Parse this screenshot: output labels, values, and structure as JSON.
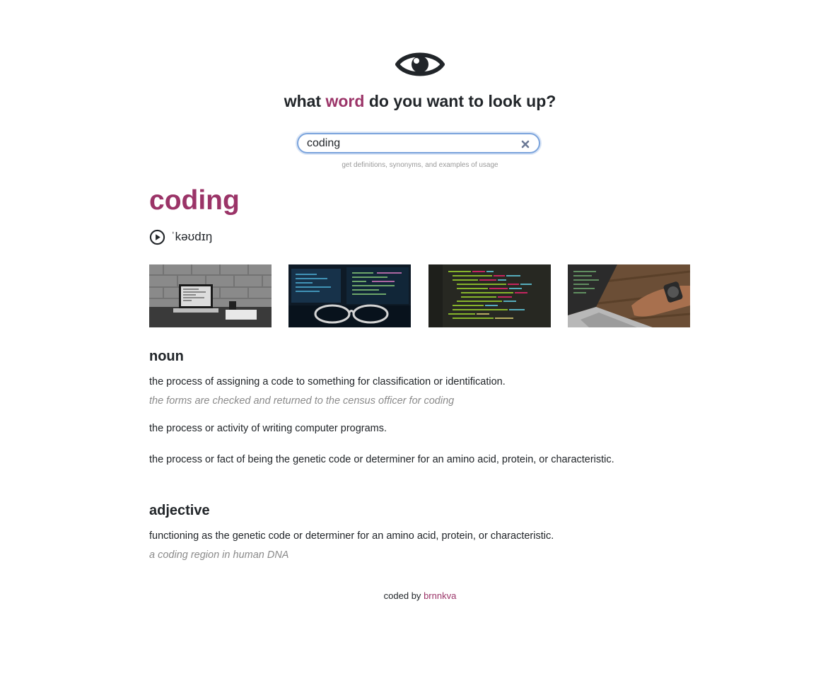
{
  "header": {
    "icon": "eye-icon",
    "title_before": "what",
    "title_accent": "word",
    "title_after": "do you want to look up?",
    "accent_color": "#9b3468"
  },
  "search": {
    "value": "coding",
    "clear_icon": "close-icon",
    "hint": "get definitions, synonyms, and examples of usage"
  },
  "result": {
    "word": "coding",
    "phonetic": "ˈkəʊdɪŋ",
    "audio_icon": "play-circle-icon",
    "images": [
      {
        "name": "laptop-on-desk-photo"
      },
      {
        "name": "monitors-with-glasses-photo"
      },
      {
        "name": "code-editor-photo"
      },
      {
        "name": "hand-on-laptop-photo"
      }
    ],
    "meanings": [
      {
        "part_of_speech": "noun",
        "definitions": [
          {
            "definition": "the process of assigning a code to something for classification or identification.",
            "example": "the forms are checked and returned to the census officer for coding"
          },
          {
            "definition": "the process or activity of writing computer programs."
          },
          {
            "definition": "the process or fact of being the genetic code or determiner for an amino acid, protein, or characteristic."
          }
        ]
      },
      {
        "part_of_speech": "adjective",
        "definitions": [
          {
            "definition": "functioning as the genetic code or determiner for an amino acid, protein, or characteristic.",
            "example": "a coding region in human DNA"
          }
        ]
      }
    ]
  },
  "footer": {
    "prefix": "coded by",
    "author": "brnnkva"
  }
}
